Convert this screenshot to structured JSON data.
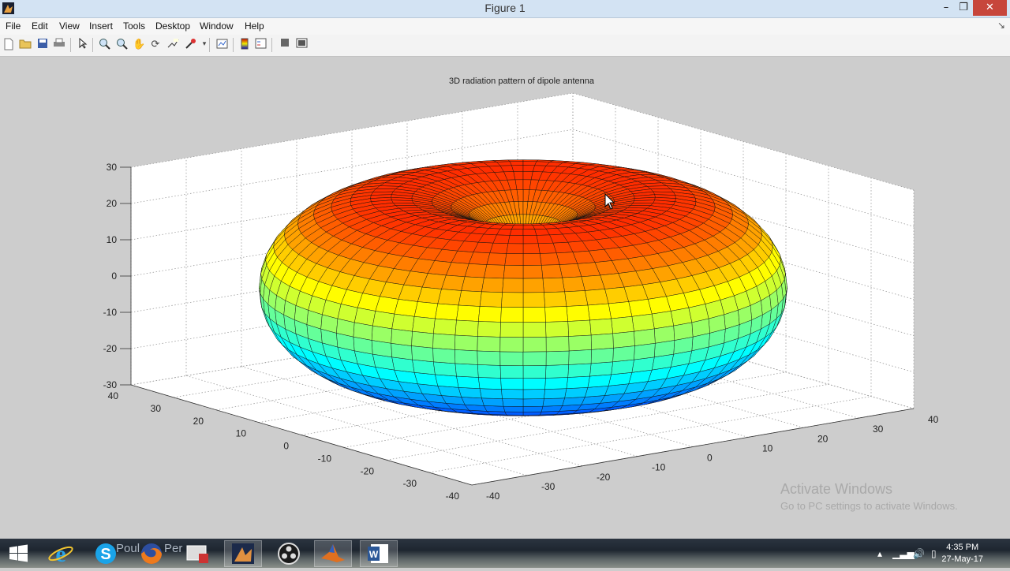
{
  "window": {
    "title": "Figure 1",
    "controls": {
      "minimize": "–",
      "maximize": "❐",
      "close": "✕"
    }
  },
  "menu": {
    "items": [
      "File",
      "Edit",
      "View",
      "Insert",
      "Tools",
      "Desktop",
      "Window",
      "Help"
    ],
    "corner": "↘"
  },
  "toolbar": {
    "buttons": [
      "new-figure-icon",
      "open-file-icon",
      "save-icon",
      "print-icon",
      "edit-plot-icon",
      "zoom-in-icon",
      "zoom-out-icon",
      "pan-icon",
      "rotate-3d-icon",
      "data-cursor-icon",
      "brush-icon",
      "link-plot-icon",
      "colorbar-icon",
      "legend-icon",
      "hide-plot-tools-icon",
      "show-plot-tools-icon"
    ]
  },
  "chart_data": {
    "type": "surface",
    "title": "3D radiation pattern of dipole antenna",
    "colormap": "jet",
    "shape": "torus (sin θ pattern)",
    "x_ticks": [
      "40",
      "30",
      "20",
      "10",
      "0",
      "-10",
      "-20",
      "-30",
      "-40"
    ],
    "y_ticks": [
      "-40",
      "-30",
      "-20",
      "-10",
      "0",
      "10",
      "20",
      "30",
      "40"
    ],
    "z_ticks": [
      "30",
      "20",
      "10",
      "0",
      "-10",
      "-20",
      "-30"
    ],
    "xlim": [
      -40,
      40
    ],
    "ylim": [
      -40,
      40
    ],
    "zlim": [
      -30,
      30
    ],
    "grid": true
  },
  "watermark": {
    "line1": "Activate Windows",
    "line2": "Go to PC settings to activate Windows."
  },
  "taskbar": {
    "apps": [
      "start-icon",
      "internet-explorer-icon",
      "skype-icon",
      "firefox-icon",
      "app-icon",
      "matlab-figure-icon",
      "obs-icon",
      "matlab-icon",
      "word-icon"
    ],
    "user_label_1": "Poul",
    "user_label_2": "Per",
    "time": "4:35 PM",
    "date": "27-May-17"
  }
}
